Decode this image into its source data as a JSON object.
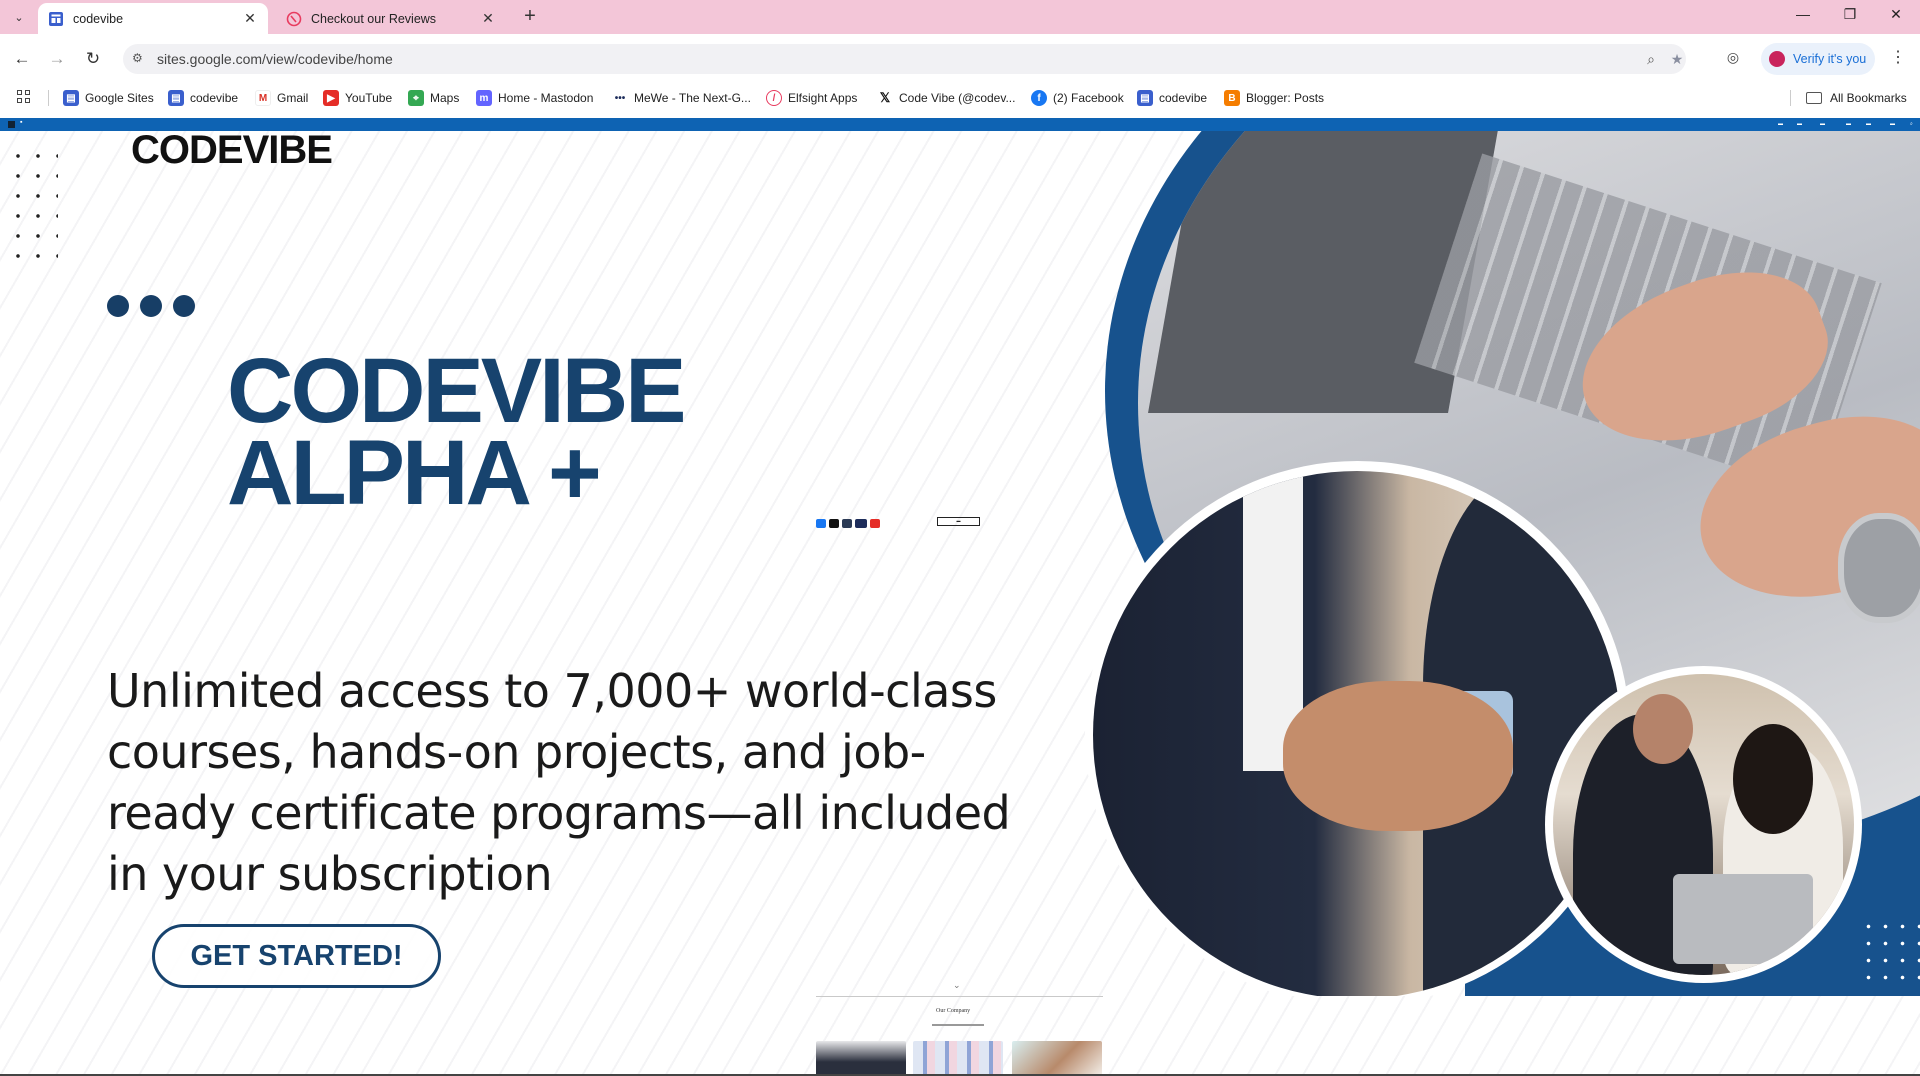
{
  "tabs": [
    {
      "title": "codevibe",
      "active": true
    },
    {
      "title": "Checkout our Reviews",
      "active": false
    }
  ],
  "toolbar": {
    "url": "sites.google.com/view/codevibe/home",
    "verify_label": "Verify it's you"
  },
  "bookmarks": [
    {
      "label": "Google Sites",
      "icon": "google-sites-icon",
      "color": "#3a5fcd"
    },
    {
      "label": "codevibe",
      "icon": "google-sites-icon",
      "color": "#3a5fcd"
    },
    {
      "label": "Gmail",
      "icon": "gmail-icon",
      "color": "#d93025"
    },
    {
      "label": "YouTube",
      "icon": "youtube-icon",
      "color": "#e52d27"
    },
    {
      "label": "Maps",
      "icon": "maps-icon",
      "color": "#34a853"
    },
    {
      "label": "Home - Mastodon",
      "icon": "mastodon-icon",
      "color": "#6364ff"
    },
    {
      "label": "MeWe - The Next-G...",
      "icon": "mewe-icon",
      "color": "#1d2d5b"
    },
    {
      "label": "Elfsight Apps",
      "icon": "elfsight-icon",
      "color": "#e83b5f"
    },
    {
      "label": "Code Vibe (@codev...",
      "icon": "x-icon",
      "color": "#111111"
    },
    {
      "label": "(2) Facebook",
      "icon": "facebook-icon",
      "color": "#1877f2"
    },
    {
      "label": "codevibe",
      "icon": "google-sites-icon",
      "color": "#3a5fcd"
    },
    {
      "label": "Blogger: Posts",
      "icon": "blogger-icon",
      "color": "#f57d00"
    }
  ],
  "all_bookmarks_label": "All Bookmarks",
  "site": {
    "logo_text": "CODEVIBE",
    "hero_title_line1": "CODEVIBE",
    "hero_title_line2": "ALPHA +",
    "subtitle": "Unlimited access to 7,000+ world-class courses, hands-on projects, and job-ready certificate programs—all included in your subscription",
    "cta_label": "GET STARTED!",
    "section_title": "Our Company",
    "colors": {
      "navy": "#17436e",
      "sitebar_blue": "#0e63b3",
      "accent_blue": "#17528d"
    }
  }
}
